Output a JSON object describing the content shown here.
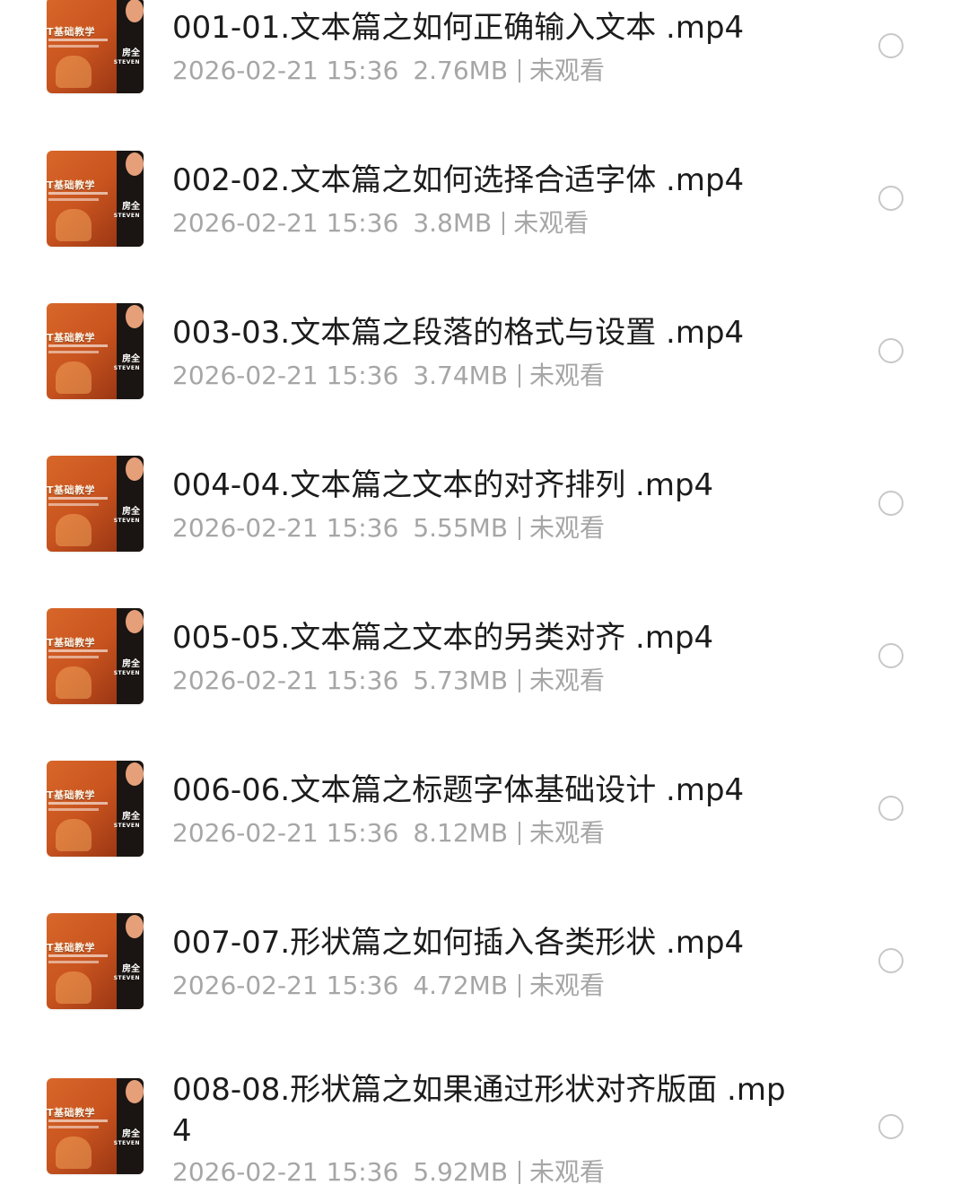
{
  "files": [
    {
      "title": "001-01.文本篇之如何正确输入文本 .mp4",
      "date": "2026-02-21 15:36",
      "size": "2.76MB",
      "status": "未观看",
      "selected": false,
      "thumb_title": "T基础教学",
      "thumb_badge": "房全",
      "thumb_badge_sub": "STEVEN"
    },
    {
      "title": "002-02.文本篇之如何选择合适字体 .mp4",
      "date": "2026-02-21 15:36",
      "size": "3.8MB",
      "status": "未观看",
      "selected": false,
      "thumb_title": "T基础教学",
      "thumb_badge": "房全",
      "thumb_badge_sub": "STEVEN"
    },
    {
      "title": "003-03.文本篇之段落的格式与设置 .mp4",
      "date": "2026-02-21 15:36",
      "size": "3.74MB",
      "status": "未观看",
      "selected": false,
      "thumb_title": "T基础教学",
      "thumb_badge": "房全",
      "thumb_badge_sub": "STEVEN"
    },
    {
      "title": "004-04.文本篇之文本的对齐排列 .mp4",
      "date": "2026-02-21 15:36",
      "size": "5.55MB",
      "status": "未观看",
      "selected": false,
      "thumb_title": "T基础教学",
      "thumb_badge": "房全",
      "thumb_badge_sub": "STEVEN"
    },
    {
      "title": "005-05.文本篇之文本的另类对齐 .mp4",
      "date": "2026-02-21 15:36",
      "size": "5.73MB",
      "status": "未观看",
      "selected": false,
      "thumb_title": "T基础教学",
      "thumb_badge": "房全",
      "thumb_badge_sub": "STEVEN"
    },
    {
      "title": "006-06.文本篇之标题字体基础设计 .mp4",
      "date": "2026-02-21 15:36",
      "size": "8.12MB",
      "status": "未观看",
      "selected": false,
      "thumb_title": "T基础教学",
      "thumb_badge": "房全",
      "thumb_badge_sub": "STEVEN"
    },
    {
      "title": "007-07.形状篇之如何插入各类形状 .mp4",
      "date": "2026-02-21 15:36",
      "size": "4.72MB",
      "status": "未观看",
      "selected": false,
      "thumb_title": "T基础教学",
      "thumb_badge": "房全",
      "thumb_badge_sub": "STEVEN"
    },
    {
      "title": "008-08.形状篇之如果通过形状对齐版面 .mp4",
      "date": "2026-02-21 15:36",
      "size": "5.92MB",
      "status": "未观看",
      "selected": false,
      "thumb_title": "T基础教学",
      "thumb_badge": "房全",
      "thumb_badge_sub": "STEVEN"
    }
  ],
  "colors": {
    "title_text": "#1c1c1c",
    "meta_text": "#a6a6a6",
    "radio_border": "#c8c8c8",
    "thumbnail_primary": "#d8672a"
  },
  "icons": {
    "select_control": "radio-unchecked-icon"
  }
}
